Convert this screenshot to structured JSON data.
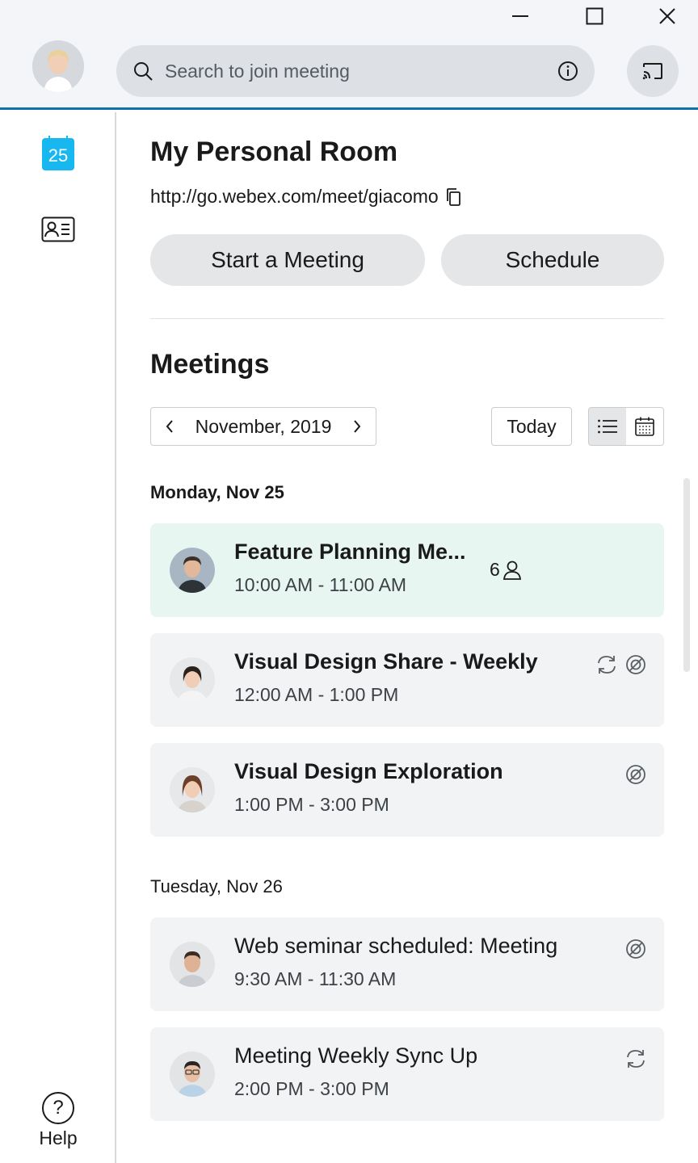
{
  "window": {
    "minimize_label": "—",
    "maximize_label": "☐",
    "close_label": "✕"
  },
  "header": {
    "search": {
      "placeholder": "Search to join meeting"
    }
  },
  "sidebar": {
    "calendar_day": "25",
    "help_label": "Help"
  },
  "personal_room": {
    "title": "My Personal Room",
    "url": "http://go.webex.com/meet/giacomo",
    "start_label": "Start a Meeting",
    "schedule_label": "Schedule"
  },
  "meetings": {
    "title": "Meetings",
    "month": "November, 2019",
    "today_label": "Today",
    "days": [
      {
        "heading": "Monday, Nov 25",
        "items": [
          {
            "title": "Feature Planning Me...",
            "time": "10:00 AM - 11:00 AM",
            "attendees": "6"
          },
          {
            "title": "Visual Design Share - Weekly",
            "time": "12:00 AM - 1:00 PM"
          },
          {
            "title": "Visual Design Exploration",
            "time": "1:00 PM - 3:00 PM"
          }
        ]
      },
      {
        "heading": "Tuesday, Nov 26",
        "items": [
          {
            "title": "Web seminar scheduled: Meeting",
            "time": "9:30 AM - 11:30 AM"
          },
          {
            "title": "Meeting Weekly Sync Up",
            "time": "2:00 PM - 3:00 PM"
          }
        ]
      }
    ]
  },
  "colors": {
    "accent": "#1070ab",
    "calendar": "#17b8f0",
    "active_card": "#e8f6f1",
    "card": "#f2f3f5"
  }
}
